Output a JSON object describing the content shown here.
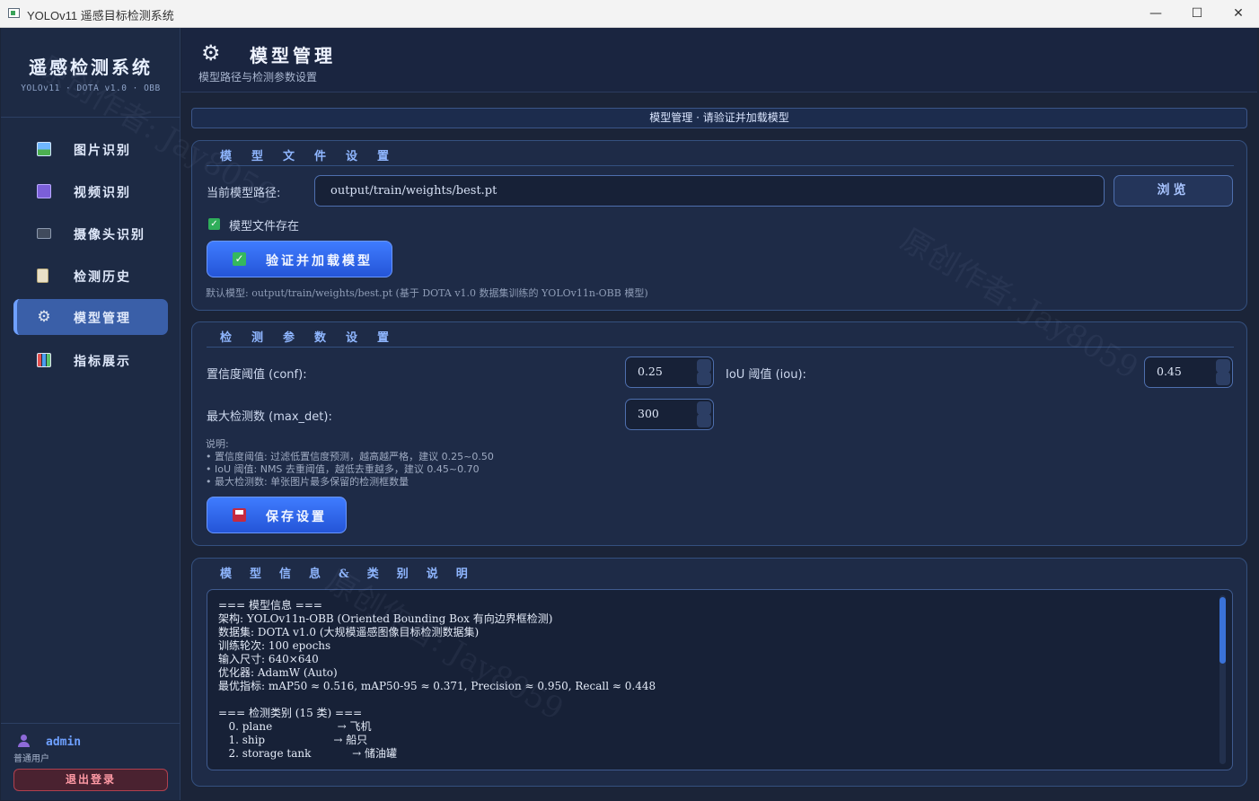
{
  "window": {
    "title": "YOLOv11 遥感目标检测系统",
    "minimize": "—",
    "maximize": "☐",
    "close": "✕"
  },
  "sidebar": {
    "brand_title": "遥感检测系统",
    "brand_subtitle": "YOLOv11 · DOTA v1.0 · OBB",
    "items": [
      {
        "label": "图片识别",
        "icon": "image-icon"
      },
      {
        "label": "视频识别",
        "icon": "video-icon"
      },
      {
        "label": "摄像头识别",
        "icon": "camera-icon"
      },
      {
        "label": "检测历史",
        "icon": "history-icon"
      },
      {
        "label": "模型管理",
        "icon": "gear-icon",
        "active": true
      },
      {
        "label": "指标展示",
        "icon": "chart-icon"
      }
    ],
    "user": {
      "name": "admin",
      "role": "普通用户",
      "logout_label": "退出登录"
    }
  },
  "header": {
    "title": "模型管理",
    "subtitle": "模型路径与检测参数设置"
  },
  "status_banner": "模型管理 · 请验证并加载模型",
  "model_file": {
    "title": "模型文件设置",
    "path_label": "当前模型路径:",
    "path_value": "output/train/weights/best.pt",
    "browse_label": "浏览",
    "exists_label": "模型文件存在",
    "exists_checked": true,
    "verify_label": "验证并加载模型",
    "default_hint": "默认模型: output/train/weights/best.pt (基于 DOTA v1.0 数据集训练的 YOLOv11n-OBB 模型)"
  },
  "detect_params": {
    "title": "检测参数设置",
    "conf_label": "置信度阈值 (conf):",
    "conf_value": "0.25",
    "iou_label": "IoU 阈值 (iou):",
    "iou_value": "0.45",
    "max_det_label": "最大检测数 (max_det):",
    "max_det_value": "300",
    "notes": "说明:\n• 置信度阈值: 过滤低置信度预测，越高越严格，建议 0.25~0.50\n• IoU 阈值: NMS 去重阈值，越低去重越多，建议 0.45~0.70\n• 最大检测数: 单张图片最多保留的检测框数量",
    "save_label": "保存设置"
  },
  "model_info": {
    "title": "模型信息&类别说明",
    "text": "=== 模型信息 ===\n架构: YOLOv11n-OBB (Oriented Bounding Box 有向边界框检测)\n数据集: DOTA v1.0 (大规模遥感图像目标检测数据集)\n训练轮次: 100 epochs\n输入尺寸: 640×640\n优化器: AdamW (Auto)\n最优指标: mAP50 ≈ 0.516, mAP50-95 ≈ 0.371, Precision ≈ 0.950, Recall ≈ 0.448\n\n=== 检测类别 (15 类) ===\n   0. plane                   → 飞机\n   1. ship                    → 船只\n   2. storage tank            → 储油罐"
  },
  "watermark": "原创作者: Jay8059"
}
